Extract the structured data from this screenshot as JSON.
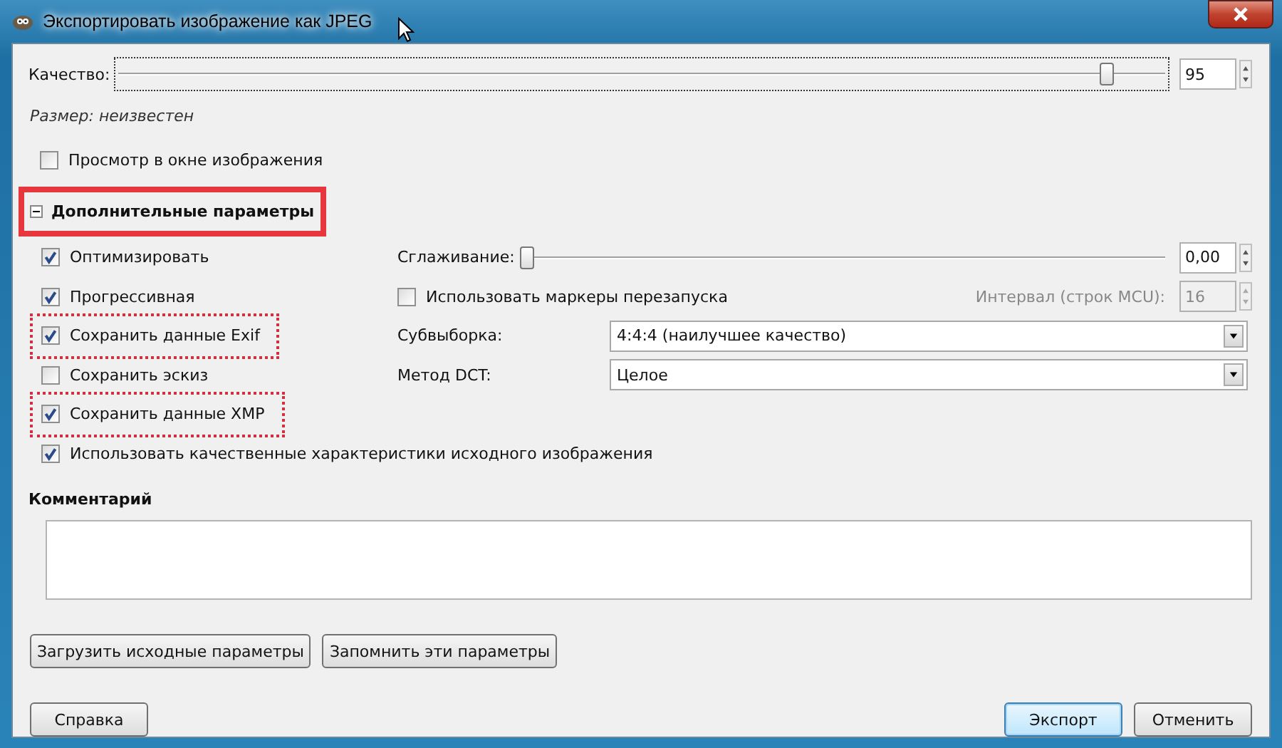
{
  "window": {
    "title": "Экспортировать изображение как JPEG"
  },
  "quality": {
    "label": "Качество:",
    "level": 0.95,
    "value": "95"
  },
  "size_info": "Размер: неизвестен",
  "preview": {
    "label": "Просмотр в окне изображения",
    "checked": false
  },
  "advanced": {
    "title": "Дополнительные параметры",
    "expanded": true,
    "highlighted": true,
    "options": [
      {
        "label": "Оптимизировать",
        "checked": true
      },
      {
        "label": "Прогрессивная",
        "checked": true
      },
      {
        "label": "Сохранить данные Exif",
        "checked": true,
        "highlighted": true
      },
      {
        "label": "Сохранить эскиз",
        "checked": false
      },
      {
        "label": "Сохранить данные XMP",
        "checked": true,
        "highlighted": true
      },
      {
        "label": "Использовать качественные характеристики исходного изображения",
        "checked": true
      }
    ],
    "smoothing": {
      "label": "Сглаживание:",
      "level": 0,
      "value": "0,00"
    },
    "restart_markers": {
      "label": "Использовать маркеры перезапуска",
      "checked": false
    },
    "interval": {
      "label": "Интервал (строк MCU):",
      "value": "16",
      "disabled": true
    },
    "subsampling": {
      "label": "Субвыборка:",
      "value": "4:4:4 (наилучшее качество)"
    },
    "dct": {
      "label": "Метод DCT:",
      "value": "Целое"
    }
  },
  "comment": {
    "label": "Комментарий"
  },
  "preset_buttons": [
    "Загрузить исходные параметры",
    "Запомнить эти параметры"
  ],
  "help_button": "Справка",
  "action_buttons": [
    {
      "label": "Экспорт",
      "default": true
    },
    {
      "label": "Отменить",
      "default": false
    }
  ]
}
